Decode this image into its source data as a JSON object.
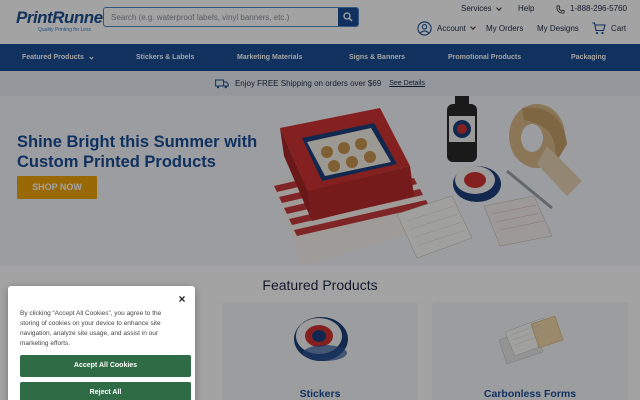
{
  "header": {
    "logo_text": "PrintRunner",
    "logo_tagline": "Quality Printing for Less",
    "search_placeholder": "Search (e.g. waterproof labels, vinyl banners, etc.)",
    "services": "Services",
    "help": "Help",
    "phone": "1-888-296-5760",
    "account": "Account",
    "my_orders": "My Orders",
    "my_designs": "My Designs",
    "cart": "Cart"
  },
  "nav": {
    "items": [
      {
        "label": "Featured Products"
      },
      {
        "label": "Stickers & Labels"
      },
      {
        "label": "Marketing Materials"
      },
      {
        "label": "Signs & Banners"
      },
      {
        "label": "Promotional Products"
      },
      {
        "label": "Packaging"
      }
    ]
  },
  "shipping": {
    "text": "Enjoy FREE Shipping on orders over $69",
    "link": "See Details"
  },
  "hero": {
    "title": "Shine Bright this Summer with Custom Printed Products",
    "button": "SHOP NOW"
  },
  "featured": {
    "title": "Featured Products",
    "cards": [
      {
        "label": ""
      },
      {
        "label": "Stickers"
      },
      {
        "label": "Carbonless Forms"
      }
    ]
  },
  "cookie": {
    "text": "By clicking “Accept All Cookies”, you agree to the storing of cookies on your device to enhance site navigation, analyze site usage, and assist in our marketing efforts.",
    "accept": "Accept All Cookies",
    "reject": "Reject All"
  },
  "colors": {
    "brand_blue": "#1c4f93",
    "cta_orange": "#f0a40c",
    "cookie_green": "#2f6b45"
  }
}
